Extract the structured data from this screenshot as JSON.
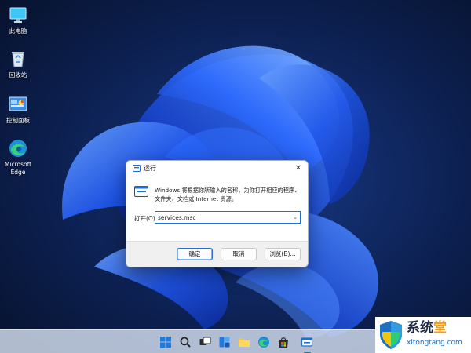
{
  "desktop": {
    "icons": [
      {
        "label": "此电脑",
        "icon": "computer-icon"
      },
      {
        "label": "回收站",
        "icon": "recycle-bin-icon"
      },
      {
        "label": "控制面板",
        "icon": "control-panel-icon"
      },
      {
        "label": "Microsoft\nEdge",
        "icon": "edge-icon"
      }
    ]
  },
  "run_dialog": {
    "title": "运行",
    "close": "✕",
    "description": "Windows 将根据你所输入的名称，为你打开相应的程序、文件夹、文档或 Internet 资源。",
    "open_label": "打开(O):",
    "input_value": "services.msc",
    "dropdown_arrow": "⌄",
    "buttons": {
      "ok": "确定",
      "cancel": "取消",
      "browse": "浏览(B)..."
    }
  },
  "taskbar": {
    "icons": [
      "start-icon",
      "search-icon",
      "task-view-icon",
      "widgets-icon",
      "file-explorer-icon",
      "edge-icon",
      "store-icon",
      "run-icon"
    ]
  },
  "watermark": {
    "title_main": "系统",
    "title_accent": "堂",
    "url": "xitongtang.com"
  },
  "colors": {
    "accent": "#1f6fd1",
    "wallpaper_dark": "#0b1a3a",
    "wallpaper_blue": "#1f55e8"
  }
}
